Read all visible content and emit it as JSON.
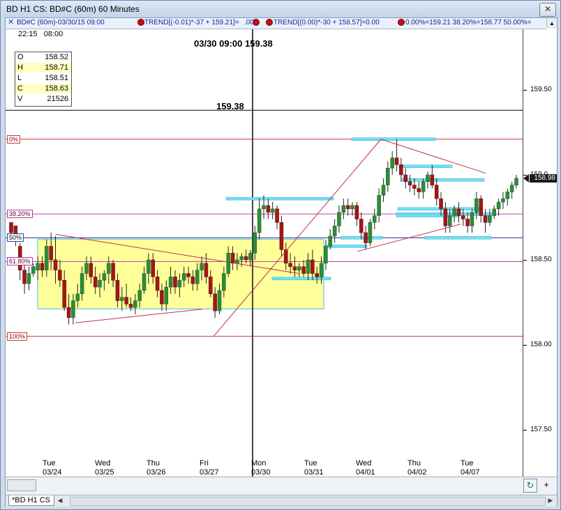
{
  "window": {
    "title": "BD H1 CS: BD#C (60m) 60 Minutes",
    "close_label": "✕"
  },
  "indicator_bar": {
    "series_label": "BD#C (60m)-03/30/15 09:00",
    "trend1": "TREND[(-0.01)*-37 + 159.21]=",
    "trend1_val": ".00",
    "trend2": "TREND[(0.00)*-30 + 158.57]=0.00",
    "fib": "0.00%=159.21 38.20%=158.77 50.00%="
  },
  "cursor_time": {
    "time": "22:15",
    "hour": "08:00"
  },
  "ohlc": [
    {
      "key": "O",
      "value": "158.52",
      "highlight": false
    },
    {
      "key": "H",
      "value": "158.71",
      "highlight": true
    },
    {
      "key": "L",
      "value": "158.51",
      "highlight": false
    },
    {
      "key": "C",
      "value": "158.63",
      "highlight": true
    },
    {
      "key": "V",
      "value": "21526",
      "highlight": false
    }
  ],
  "cursor_label": "03/30 09:00  159.38",
  "price_tag": "159.38",
  "fib_levels": [
    {
      "label": "0%",
      "price": 159.21
    },
    {
      "label": "38.20%",
      "price": 158.77
    },
    {
      "label": "50%",
      "price": 158.63
    },
    {
      "label": "61.80%",
      "price": 158.49
    },
    {
      "label": "100%",
      "price": 158.05
    }
  ],
  "y_ticks": [
    "159.50",
    "159.0",
    "158.50",
    "158.00",
    "157.50"
  ],
  "y_current": "158.98",
  "x_days": [
    {
      "day": "Tue",
      "date": "03/24"
    },
    {
      "day": "Wed",
      "date": "03/25"
    },
    {
      "day": "Thu",
      "date": "03/26"
    },
    {
      "day": "Fri",
      "date": "03/27"
    },
    {
      "day": "Mon",
      "date": "03/30"
    },
    {
      "day": "Tue",
      "date": "03/31"
    },
    {
      "day": "Wed",
      "date": "04/01"
    },
    {
      "day": "Thu",
      "date": "04/02"
    },
    {
      "day": "Tue",
      "date": "04/07"
    }
  ],
  "x_hours": [
    "03/25",
    "08:00",
    "08:00",
    "08:00",
    "08:00",
    "08:00",
    "08:00",
    "08:00",
    "08:00",
    "08:00"
  ],
  "tab_label": "*BD H1 CS",
  "chart_data": {
    "type": "candlestick",
    "title": "BD H1 CS: BD#C (60m) 60 Minutes",
    "ylim": [
      157.2,
      159.8
    ],
    "horizontal_lines": [
      159.38,
      159.21,
      158.77,
      158.63,
      158.49,
      158.05
    ],
    "candles": [
      [
        158.72,
        158.7,
        158.62,
        158.66
      ],
      [
        158.7,
        158.7,
        158.58,
        158.62
      ],
      [
        158.58,
        158.6,
        158.38,
        158.44
      ],
      [
        158.44,
        158.48,
        158.3,
        158.36
      ],
      [
        158.36,
        158.46,
        158.32,
        158.42
      ],
      [
        158.42,
        158.48,
        158.4,
        158.46
      ],
      [
        158.44,
        158.52,
        158.38,
        158.48
      ],
      [
        158.48,
        158.52,
        158.4,
        158.44
      ],
      [
        158.44,
        158.62,
        158.4,
        158.58
      ],
      [
        158.58,
        158.66,
        158.44,
        158.5
      ],
      [
        158.5,
        158.64,
        158.36,
        158.44
      ],
      [
        158.44,
        158.5,
        158.34,
        158.38
      ],
      [
        158.38,
        158.44,
        158.2,
        158.22
      ],
      [
        158.22,
        158.3,
        158.12,
        158.16
      ],
      [
        158.16,
        158.3,
        158.12,
        158.26
      ],
      [
        158.26,
        158.36,
        158.22,
        158.3
      ],
      [
        158.3,
        158.46,
        158.26,
        158.42
      ],
      [
        158.42,
        158.52,
        158.38,
        158.48
      ],
      [
        158.48,
        158.52,
        158.36,
        158.4
      ],
      [
        158.4,
        158.46,
        158.3,
        158.34
      ],
      [
        158.34,
        158.42,
        158.28,
        158.38
      ],
      [
        158.38,
        158.44,
        158.32,
        158.42
      ],
      [
        158.42,
        158.52,
        158.36,
        158.48
      ],
      [
        158.48,
        158.5,
        158.34,
        158.38
      ],
      [
        158.38,
        158.42,
        158.22,
        158.26
      ],
      [
        158.26,
        158.34,
        158.2,
        158.28
      ],
      [
        158.28,
        158.36,
        158.22,
        158.24
      ],
      [
        158.24,
        158.28,
        158.2,
        158.22
      ],
      [
        158.22,
        158.3,
        158.18,
        158.26
      ],
      [
        158.26,
        158.36,
        158.22,
        158.32
      ],
      [
        158.32,
        158.46,
        158.3,
        158.42
      ],
      [
        158.42,
        158.54,
        158.36,
        158.5
      ],
      [
        158.5,
        158.54,
        158.36,
        158.4
      ],
      [
        158.4,
        158.44,
        158.28,
        158.32
      ],
      [
        158.32,
        158.36,
        158.2,
        158.24
      ],
      [
        158.24,
        158.38,
        158.2,
        158.34
      ],
      [
        158.34,
        158.46,
        158.3,
        158.4
      ],
      [
        158.4,
        158.44,
        158.3,
        158.34
      ],
      [
        158.34,
        158.42,
        158.28,
        158.38
      ],
      [
        158.38,
        158.46,
        158.34,
        158.42
      ],
      [
        158.42,
        158.46,
        158.36,
        158.4
      ],
      [
        158.4,
        158.44,
        158.32,
        158.36
      ],
      [
        158.36,
        158.48,
        158.32,
        158.44
      ],
      [
        158.44,
        158.52,
        158.38,
        158.48
      ],
      [
        158.48,
        158.54,
        158.36,
        158.4
      ],
      [
        158.4,
        158.44,
        158.28,
        158.3
      ],
      [
        158.3,
        158.34,
        158.16,
        158.2
      ],
      [
        158.2,
        158.36,
        158.18,
        158.32
      ],
      [
        158.32,
        158.46,
        158.28,
        158.42
      ],
      [
        158.42,
        158.58,
        158.4,
        158.54
      ],
      [
        158.54,
        158.58,
        158.44,
        158.48
      ],
      [
        158.48,
        158.54,
        158.44,
        158.5
      ],
      [
        158.5,
        158.54,
        158.46,
        158.52
      ],
      [
        158.52,
        158.56,
        158.48,
        158.5
      ],
      [
        158.5,
        158.56,
        158.46,
        158.54
      ],
      [
        158.54,
        158.7,
        158.5,
        158.66
      ],
      [
        158.66,
        158.86,
        158.62,
        158.8
      ],
      [
        158.8,
        158.88,
        158.74,
        158.82
      ],
      [
        158.82,
        158.86,
        158.74,
        158.78
      ],
      [
        158.78,
        158.84,
        158.74,
        158.8
      ],
      [
        158.8,
        158.82,
        158.68,
        158.72
      ],
      [
        158.72,
        158.76,
        158.52,
        158.56
      ],
      [
        158.56,
        158.6,
        158.44,
        158.48
      ],
      [
        158.48,
        158.54,
        158.42,
        158.46
      ],
      [
        158.46,
        158.52,
        158.4,
        158.44
      ],
      [
        158.44,
        158.48,
        158.4,
        158.46
      ],
      [
        158.46,
        158.5,
        158.4,
        158.42
      ],
      [
        158.42,
        158.54,
        158.38,
        158.5
      ],
      [
        158.5,
        158.56,
        158.38,
        158.42
      ],
      [
        158.42,
        158.46,
        158.36,
        158.4
      ],
      [
        158.4,
        158.52,
        158.36,
        158.48
      ],
      [
        158.48,
        158.62,
        158.44,
        158.58
      ],
      [
        158.58,
        158.68,
        158.56,
        158.64
      ],
      [
        158.64,
        158.74,
        158.6,
        158.7
      ],
      [
        158.7,
        158.82,
        158.66,
        158.78
      ],
      [
        158.78,
        158.86,
        158.74,
        158.82
      ],
      [
        158.82,
        158.86,
        158.76,
        158.8
      ],
      [
        158.8,
        158.84,
        158.76,
        158.82
      ],
      [
        158.82,
        158.84,
        158.7,
        158.74
      ],
      [
        158.74,
        158.78,
        158.62,
        158.66
      ],
      [
        158.66,
        158.7,
        158.56,
        158.6
      ],
      [
        158.6,
        158.74,
        158.58,
        158.72
      ],
      [
        158.72,
        158.8,
        158.68,
        158.76
      ],
      [
        158.76,
        158.92,
        158.72,
        158.88
      ],
      [
        158.88,
        158.98,
        158.84,
        158.94
      ],
      [
        158.94,
        159.08,
        158.9,
        159.04
      ],
      [
        159.04,
        159.14,
        159.0,
        159.1
      ],
      [
        159.1,
        159.21,
        159.02,
        159.06
      ],
      [
        159.06,
        159.1,
        158.96,
        159.0
      ],
      [
        159.0,
        159.04,
        158.92,
        158.96
      ],
      [
        158.96,
        159.0,
        158.9,
        158.94
      ],
      [
        158.94,
        158.98,
        158.88,
        158.92
      ],
      [
        158.92,
        158.96,
        158.86,
        158.9
      ],
      [
        158.9,
        158.98,
        158.86,
        158.96
      ],
      [
        158.96,
        159.02,
        158.92,
        159.0
      ],
      [
        159.0,
        159.06,
        158.92,
        158.94
      ],
      [
        158.94,
        158.98,
        158.82,
        158.86
      ],
      [
        158.86,
        158.9,
        158.76,
        158.8
      ],
      [
        158.8,
        158.84,
        158.66,
        158.7
      ],
      [
        158.7,
        158.8,
        158.66,
        158.76
      ],
      [
        158.76,
        158.82,
        158.72,
        158.8
      ],
      [
        158.8,
        158.84,
        158.72,
        158.76
      ],
      [
        158.76,
        158.8,
        158.7,
        158.74
      ],
      [
        158.74,
        158.78,
        158.66,
        158.7
      ],
      [
        158.7,
        158.8,
        158.66,
        158.78
      ],
      [
        158.78,
        158.9,
        158.74,
        158.86
      ],
      [
        158.86,
        158.88,
        158.72,
        158.76
      ],
      [
        158.76,
        158.8,
        158.66,
        158.72
      ],
      [
        158.72,
        158.8,
        158.7,
        158.76
      ],
      [
        158.76,
        158.82,
        158.74,
        158.8
      ],
      [
        158.8,
        158.86,
        158.76,
        158.84
      ],
      [
        158.84,
        158.9,
        158.8,
        158.86
      ],
      [
        158.86,
        158.92,
        158.82,
        158.9
      ],
      [
        158.9,
        158.96,
        158.86,
        158.94
      ],
      [
        158.94,
        159.0,
        158.92,
        158.98
      ]
    ],
    "x_labels": [
      "03/24",
      "03/25",
      "03/26",
      "03/27",
      "03/30",
      "03/31",
      "04/01",
      "04/02",
      "04/07"
    ]
  }
}
